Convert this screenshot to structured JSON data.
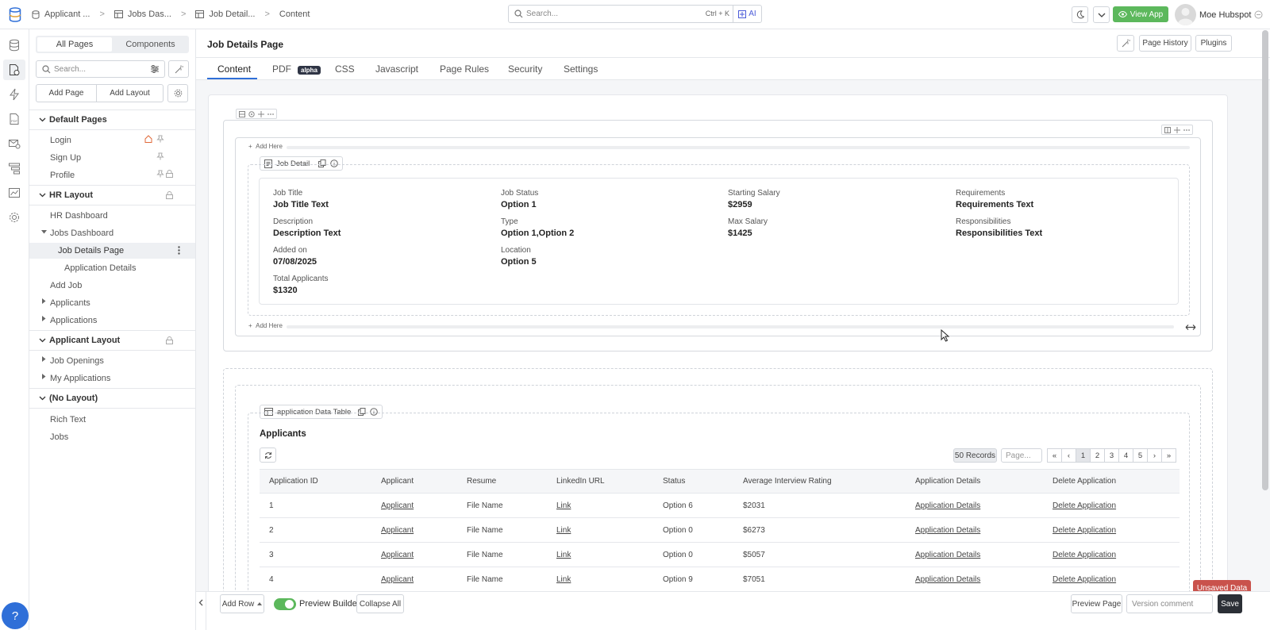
{
  "breadcrumb": [
    "Applicant ...",
    "Jobs Das...",
    "Job Detail...",
    "Content"
  ],
  "search": {
    "placeholder": "Search...",
    "shortcut": "Ctrl + K",
    "ai_label": "AI"
  },
  "header": {
    "view_app": "View App",
    "user": "Moe Hubspot"
  },
  "sidebar": {
    "tabs": [
      "All Pages",
      "Components"
    ],
    "search_placeholder": "Search...",
    "add_page": "Add Page",
    "add_layout": "Add Layout",
    "sections": [
      {
        "title": "Default Pages",
        "items": [
          "Login",
          "Sign Up",
          "Profile"
        ]
      },
      {
        "title": "HR Layout",
        "items": [
          "HR Dashboard",
          "Jobs Dashboard",
          "Job Details Page",
          "Application Details",
          "Add Job",
          "Applicants",
          "Applications"
        ]
      },
      {
        "title": "Applicant Layout",
        "items": [
          "Job Openings",
          "My Applications"
        ]
      },
      {
        "title": "(No Layout)",
        "items": [
          "Rich Text",
          "Jobs"
        ]
      }
    ]
  },
  "page": {
    "title": "Job Details Page",
    "page_history": "Page History",
    "plugins": "Plugins",
    "tabs": [
      "Content",
      "PDF",
      "CSS",
      "Javascript",
      "Page Rules",
      "Security",
      "Settings"
    ],
    "alpha_badge": "alpha"
  },
  "builder": {
    "add_here": "Add Here",
    "job_detail_tag": "Job Detail",
    "fields": [
      {
        "label": "Job Title",
        "value": "Job Title Text"
      },
      {
        "label": "Job Status",
        "value": "Option 1"
      },
      {
        "label": "Starting Salary",
        "value": "$2959"
      },
      {
        "label": "Requirements",
        "value": "Requirements Text"
      },
      {
        "label": "Description",
        "value": "Description Text"
      },
      {
        "label": "Type",
        "value": "Option 1,Option 2"
      },
      {
        "label": "Max Salary",
        "value": "$1425"
      },
      {
        "label": "Responsibilities",
        "value": "Responsibilities Text"
      },
      {
        "label": "Added on",
        "value": "07/08/2025"
      },
      {
        "label": "Location",
        "value": "Option 5"
      },
      {
        "label": "Total Applicants",
        "value": "$1320"
      }
    ],
    "table_tag": "application Data Table",
    "table_title": "Applicants",
    "records": "50 Records",
    "page_placeholder": "Page...",
    "pages": [
      "«",
      "‹",
      "1",
      "2",
      "3",
      "4",
      "5",
      "›",
      "»"
    ],
    "columns": [
      "Application ID",
      "Applicant",
      "Resume",
      "LinkedIn URL",
      "Status",
      "Average Interview Rating",
      "Application Details",
      "Delete Application"
    ],
    "rows": [
      [
        "1",
        "Applicant",
        "File Name",
        "Link",
        "Option 6",
        "$2031",
        "Application Details",
        "Delete Application"
      ],
      [
        "2",
        "Applicant",
        "File Name",
        "Link",
        "Option 0",
        "$6273",
        "Application Details",
        "Delete Application"
      ],
      [
        "3",
        "Applicant",
        "File Name",
        "Link",
        "Option 0",
        "$5057",
        "Application Details",
        "Delete Application"
      ],
      [
        "4",
        "Applicant",
        "File Name",
        "Link",
        "Option 9",
        "$7051",
        "Application Details",
        "Delete Application"
      ]
    ]
  },
  "bottom": {
    "add_row": "Add Row",
    "preview_builder": "Preview Builder",
    "collapse_all": "Collapse All",
    "preview_page": "Preview Page",
    "version_placeholder": "Version comment",
    "save": "Save",
    "unsaved": "Unsaved Data",
    "help": "?"
  }
}
